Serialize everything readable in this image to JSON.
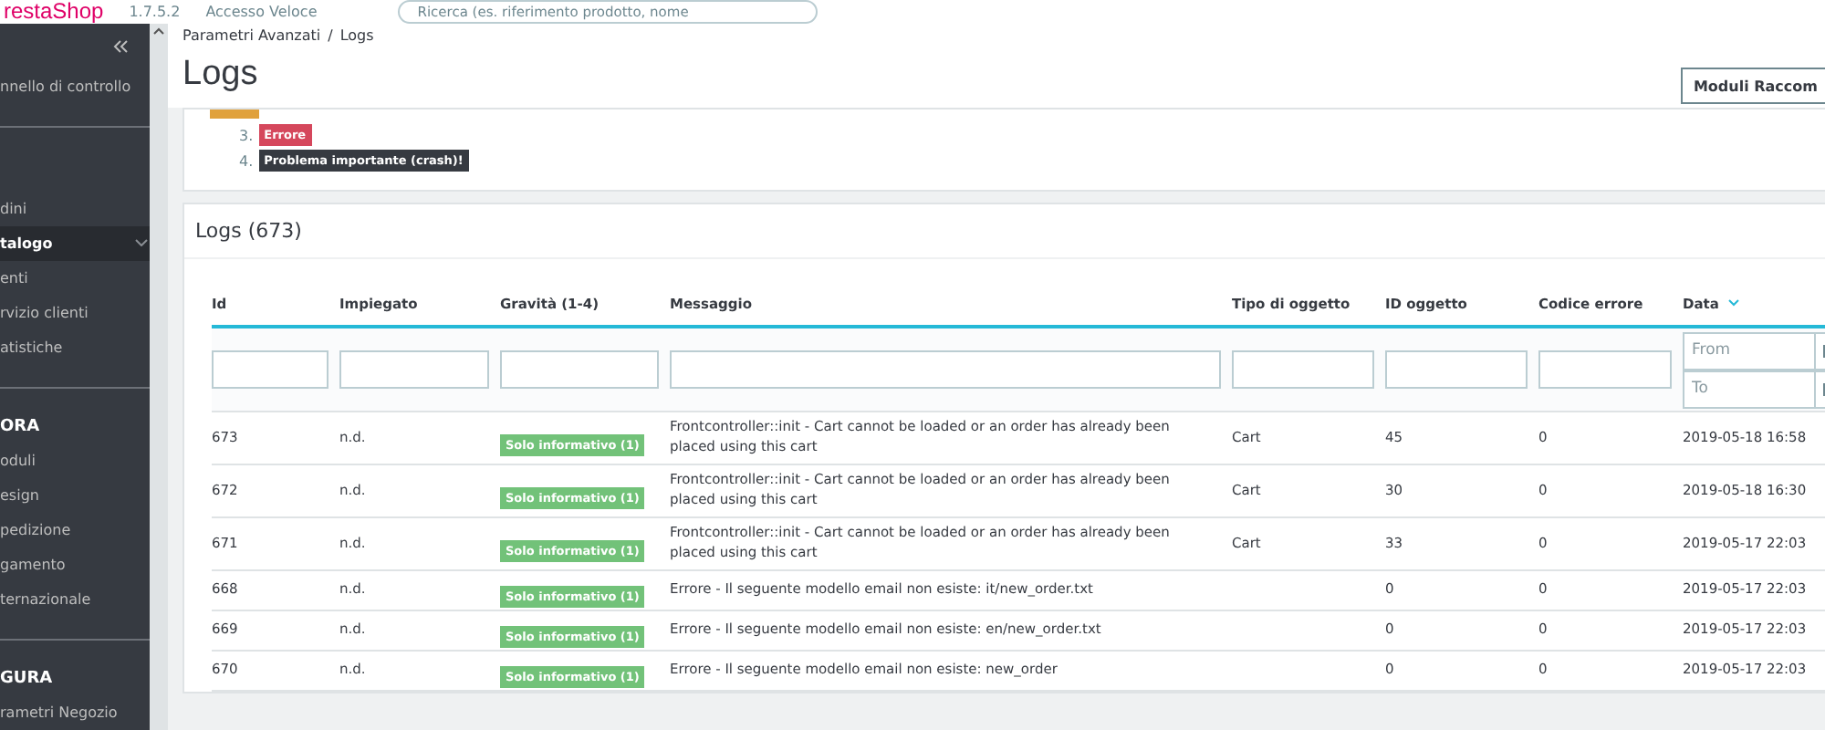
{
  "topbar": {
    "logo": "restaShop",
    "version": "1.7.5.2",
    "quick_access": "Accesso Veloce",
    "search": {
      "placeholder": "Ricerca (es. riferimento prodotto, nome"
    }
  },
  "sidebar": {
    "items": [
      {
        "kind": "link",
        "label": "nnello di controllo",
        "selected": false,
        "submenu": false
      },
      {
        "kind": "divider"
      },
      {
        "kind": "link",
        "label": "dini",
        "selected": false,
        "submenu": false
      },
      {
        "kind": "link",
        "label": "talogo",
        "selected": true,
        "submenu": true
      },
      {
        "kind": "link",
        "label": "enti",
        "selected": false,
        "submenu": false
      },
      {
        "kind": "link",
        "label": "rvizio clienti",
        "selected": false,
        "submenu": false
      },
      {
        "kind": "link",
        "label": "atistiche",
        "selected": false,
        "submenu": false
      },
      {
        "kind": "divider"
      },
      {
        "kind": "section",
        "label": "ORA"
      },
      {
        "kind": "link",
        "label": "oduli",
        "selected": false,
        "submenu": false
      },
      {
        "kind": "link",
        "label": "esign",
        "selected": false,
        "submenu": false
      },
      {
        "kind": "link",
        "label": "pedizione",
        "selected": false,
        "submenu": false
      },
      {
        "kind": "link",
        "label": "gamento",
        "selected": false,
        "submenu": false
      },
      {
        "kind": "link",
        "label": "ternazionale",
        "selected": false,
        "submenu": false
      },
      {
        "kind": "divider"
      },
      {
        "kind": "section",
        "label": "GURA"
      },
      {
        "kind": "link",
        "label": "rametri Negozio",
        "selected": false,
        "submenu": false
      }
    ]
  },
  "header": {
    "breadcrumb": [
      "Parametri Avanzati",
      "Logs"
    ],
    "breadcrumb_separator": "/",
    "title": "Logs",
    "button": "Moduli Raccom"
  },
  "severity_legend": [
    {
      "number": "3.",
      "label": "Errore",
      "kind": "error"
    },
    {
      "number": "4.",
      "label": "Problema importante (crash)!",
      "kind": "crash"
    }
  ],
  "table": {
    "title": "Logs (673)",
    "columns": [
      {
        "label": "Id",
        "sorted": false
      },
      {
        "label": "Impiegato",
        "sorted": false
      },
      {
        "label": "Gravità (1-4)",
        "sorted": false
      },
      {
        "label": "Messaggio",
        "sorted": false
      },
      {
        "label": "Tipo di oggetto",
        "sorted": false
      },
      {
        "label": "ID oggetto",
        "sorted": false
      },
      {
        "label": "Codice errore",
        "sorted": false
      },
      {
        "label": "Data",
        "sorted": true
      }
    ],
    "date_filter": {
      "from_placeholder": "From",
      "to_placeholder": "To"
    },
    "rows": [
      {
        "id": "673",
        "employee": "n.d.",
        "severity": {
          "label": "Solo informativo (1)",
          "kind": "info"
        },
        "message": "Frontcontroller::init - Cart cannot be loaded or an order has already been placed using this cart",
        "object_type": "Cart",
        "object_id": "45",
        "error_code": "0",
        "date": "2019-05-18 16:58"
      },
      {
        "id": "672",
        "employee": "n.d.",
        "severity": {
          "label": "Solo informativo (1)",
          "kind": "info"
        },
        "message": "Frontcontroller::init - Cart cannot be loaded or an order has already been placed using this cart",
        "object_type": "Cart",
        "object_id": "30",
        "error_code": "0",
        "date": "2019-05-18 16:30"
      },
      {
        "id": "671",
        "employee": "n.d.",
        "severity": {
          "label": "Solo informativo (1)",
          "kind": "info"
        },
        "message": "Frontcontroller::init - Cart cannot be loaded or an order has already been placed using this cart",
        "object_type": "Cart",
        "object_id": "33",
        "error_code": "0",
        "date": "2019-05-17 22:03"
      },
      {
        "id": "668",
        "employee": "n.d.",
        "severity": {
          "label": "Solo informativo (1)",
          "kind": "info"
        },
        "message": "Errore - Il seguente modello email non esiste: it/new_order.txt",
        "object_id": "0",
        "error_code": "0",
        "date": "2019-05-17 22:03"
      },
      {
        "id": "669",
        "employee": "n.d.",
        "severity": {
          "label": "Solo informativo (1)",
          "kind": "info"
        },
        "message": "Errore - Il seguente modello email non esiste: en/new_order.txt",
        "object_id": "0",
        "error_code": "0",
        "date": "2019-05-17 22:03"
      },
      {
        "id": "670",
        "employee": "n.d.",
        "severity": {
          "label": "Solo informativo (1)",
          "kind": "info"
        },
        "message": "Errore - Il seguente modello email non esiste: new_order",
        "object_id": "0",
        "error_code": "0",
        "date": "2019-05-17 22:03"
      }
    ]
  }
}
